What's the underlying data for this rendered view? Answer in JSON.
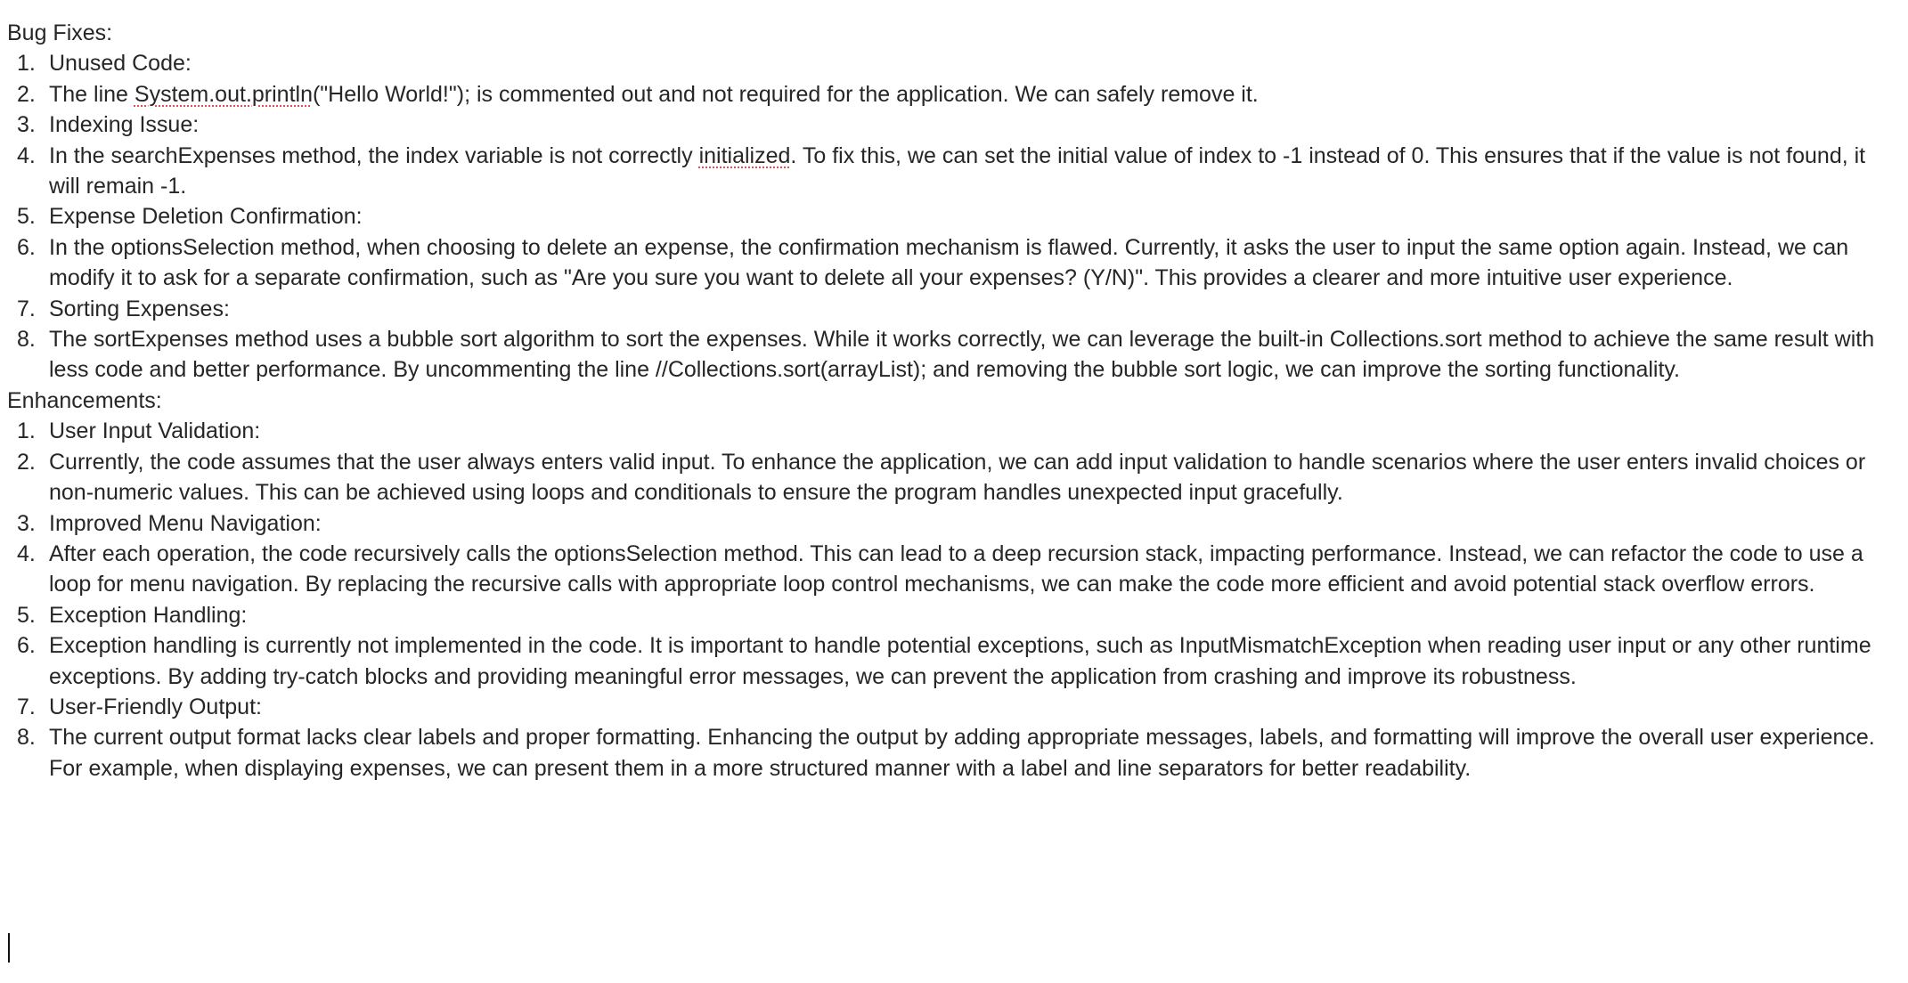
{
  "sections": [
    {
      "heading": "Bug Fixes:",
      "items": [
        {
          "num": "1.",
          "text": "Unused Code:"
        },
        {
          "num": "2.",
          "pre": "The line ",
          "misspelled": "System.out.println",
          "post": "(\"Hello World!\"); is commented out and not required for the application. We can safely remove it."
        },
        {
          "num": "3.",
          "text": "Indexing Issue:"
        },
        {
          "num": "4.",
          "pre": "In the searchExpenses method, the index variable is not correctly ",
          "misspelled": "initialized",
          "post": ". To fix this, we can set the initial value of index to -1 instead of 0. This ensures that if the value is not found, it will remain -1."
        },
        {
          "num": "5.",
          "text": "Expense Deletion Confirmation:"
        },
        {
          "num": "6.",
          "text": "In the optionsSelection method, when choosing to delete an expense, the confirmation mechanism is flawed. Currently, it asks the user to input the same option again. Instead, we can modify it to ask for a separate confirmation, such as \"Are you sure you want to delete all your expenses? (Y/N)\". This provides a clearer and more intuitive user experience."
        },
        {
          "num": "7.",
          "text": "Sorting Expenses:"
        },
        {
          "num": "8.",
          "text": "The sortExpenses method uses a bubble sort algorithm to sort the expenses. While it works correctly, we can leverage the built-in Collections.sort method to achieve the same result with less code and better performance. By uncommenting the line //Collections.sort(arrayList); and removing the bubble sort logic, we can improve the sorting functionality."
        }
      ]
    },
    {
      "heading": "Enhancements:",
      "items": [
        {
          "num": "1.",
          "text": "User Input Validation:"
        },
        {
          "num": "2.",
          "text": "Currently, the code assumes that the user always enters valid input. To enhance the application, we can add input validation to handle scenarios where the user enters invalid choices or non-numeric values. This can be achieved using loops and conditionals to ensure the program handles unexpected input gracefully."
        },
        {
          "num": "3.",
          "text": "Improved Menu Navigation:"
        },
        {
          "num": "4.",
          "text": "After each operation, the code recursively calls the optionsSelection method. This can lead to a deep recursion stack, impacting performance. Instead, we can refactor the code to use a loop for menu navigation. By replacing the recursive calls with appropriate loop control mechanisms, we can make the code more efficient and avoid potential stack overflow errors."
        },
        {
          "num": "5.",
          "text": "Exception Handling:"
        },
        {
          "num": "6.",
          "text": "Exception handling is currently not implemented in the code. It is important to handle potential exceptions, such as InputMismatchException when reading user input or any other runtime exceptions. By adding try-catch blocks and providing meaningful error messages, we can prevent the application from crashing and improve its robustness."
        },
        {
          "num": "7.",
          "text": "User-Friendly Output:"
        },
        {
          "num": "8.",
          "text": "The current output format lacks clear labels and proper formatting. Enhancing the output by adding appropriate messages, labels, and formatting will improve the overall user experience. For example, when displaying expenses, we can present them in a more structured manner with a label and line separators for better readability."
        }
      ]
    }
  ]
}
